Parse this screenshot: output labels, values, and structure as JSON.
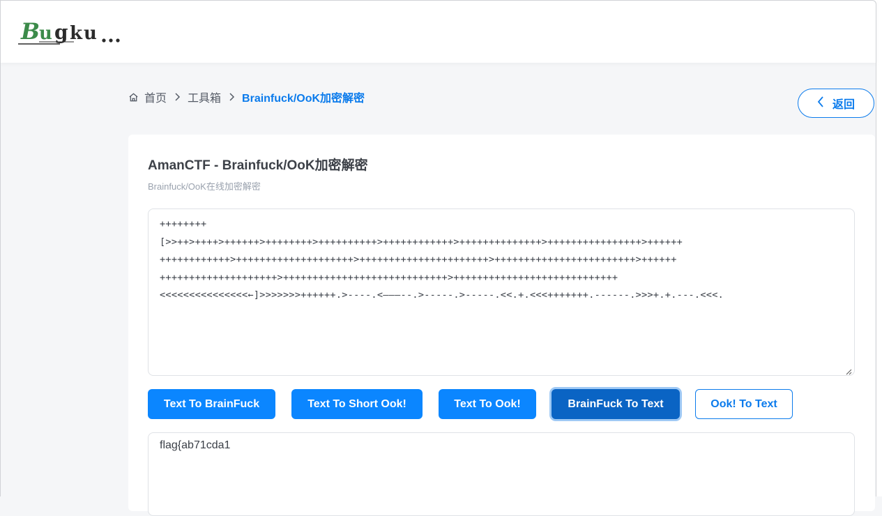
{
  "header": {
    "logo_text": "Bugku..."
  },
  "breadcrumb": {
    "home": "首页",
    "toolbox": "工具箱",
    "current": "Brainfuck/OoK加密解密"
  },
  "back_button": {
    "label": "返回"
  },
  "card": {
    "title": "AmanCTF - Brainfuck/OoK加密解密",
    "subtitle": "Brainfuck/OoK在线加密解密"
  },
  "input": {
    "lines": [
      "++++++++",
      "[>>++>++++>++++++>++++++++>++++++++++>++++++++++++>++++++++++++++>++++++++++++++++>++++++",
      "++++++++++++>++++++++++++++++++++>++++++++++++++++++++++>++++++++++++++++++++++++>++++++",
      "++++++++++++++++++++>++++++++++++++++++++++++++++>++++++++++++++++++++++++++++",
      "<<<<<<<<<<<<<<<←]>>>>>>>++++++.>----.<———--.>-----.>-----.<<.+.<<<+++++++.------.>>>+.+.---.<<<."
    ]
  },
  "buttons": {
    "text_to_brainfuck": "Text To BrainFuck",
    "text_to_short_ook": "Text To Short Ook!",
    "text_to_ook": "Text To Ook!",
    "brainfuck_to_text": "BrainFuck To Text",
    "ook_to_text": "Ook! To Text"
  },
  "output": {
    "value": "flag{ab71cda1"
  },
  "colors": {
    "accent": "#0b86ff",
    "accent_active": "#0a64c4",
    "link": "#0b7bec",
    "logo_green": "#3c8b4a"
  }
}
